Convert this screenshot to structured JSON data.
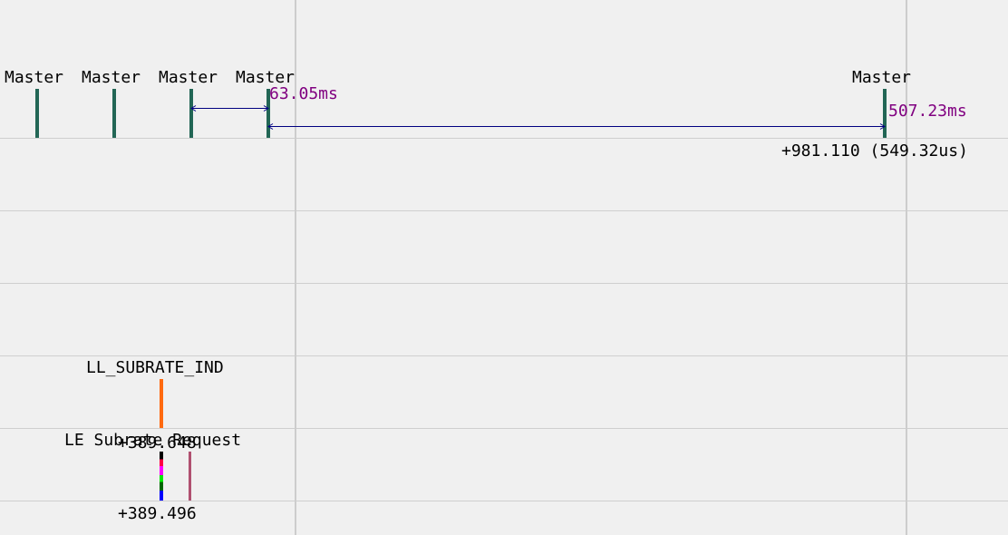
{
  "colors": {
    "background": "#f0f0f0",
    "grid": "#cfcfcf",
    "master_marker": "#226655",
    "interval_arrow": "#000080",
    "duration_text": "#800080",
    "subrate_marker": "#ff6a10",
    "request_marker": "#b05070"
  },
  "master_events": [
    "Master",
    "Master",
    "Master",
    "Master",
    "Master"
  ],
  "intervals": [
    {
      "label": "63.05ms"
    },
    {
      "label": "507.23ms"
    }
  ],
  "master_timestamp": "+981.110 (549.32us)",
  "ll_event": {
    "label": "LL_SUBRATE_IND"
  },
  "le_event": {
    "label": "LE Subrate Request",
    "overlap_label": "+389.648",
    "timestamp": "+389.496"
  }
}
